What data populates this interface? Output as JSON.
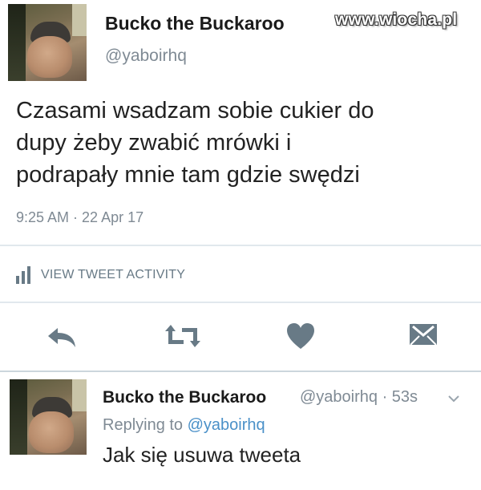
{
  "main_tweet": {
    "author_name": "Bucko the Buckaroo",
    "author_handle": "@yaboirhq",
    "text_lines": [
      "Czasami wsadzam sobie cukier do",
      "dupy żeby zwabić mrówki i",
      "podrapały mnie tam gdzie swędzi"
    ],
    "timestamp": "9:25 AM · 22 Apr 17",
    "activity_label": "VIEW TWEET ACTIVITY"
  },
  "watermark": "www.wiocha.pl",
  "actions": {
    "icons": [
      "reply-icon",
      "retweet-icon",
      "like-icon",
      "direct-message-icon"
    ],
    "color": "#687a86"
  },
  "reply_tweet": {
    "author_name": "Bucko the Buckaroo",
    "author_handle_time": "@yaboirhq · 53s",
    "replying_prefix": "Replying to",
    "replying_handle": "@yaboirhq",
    "text": "Jak się usuwa tweeta"
  },
  "colors": {
    "text": "#14171a",
    "secondary": "#7f8a94",
    "link": "#4a90c8",
    "divider": "#e1e8ed"
  }
}
